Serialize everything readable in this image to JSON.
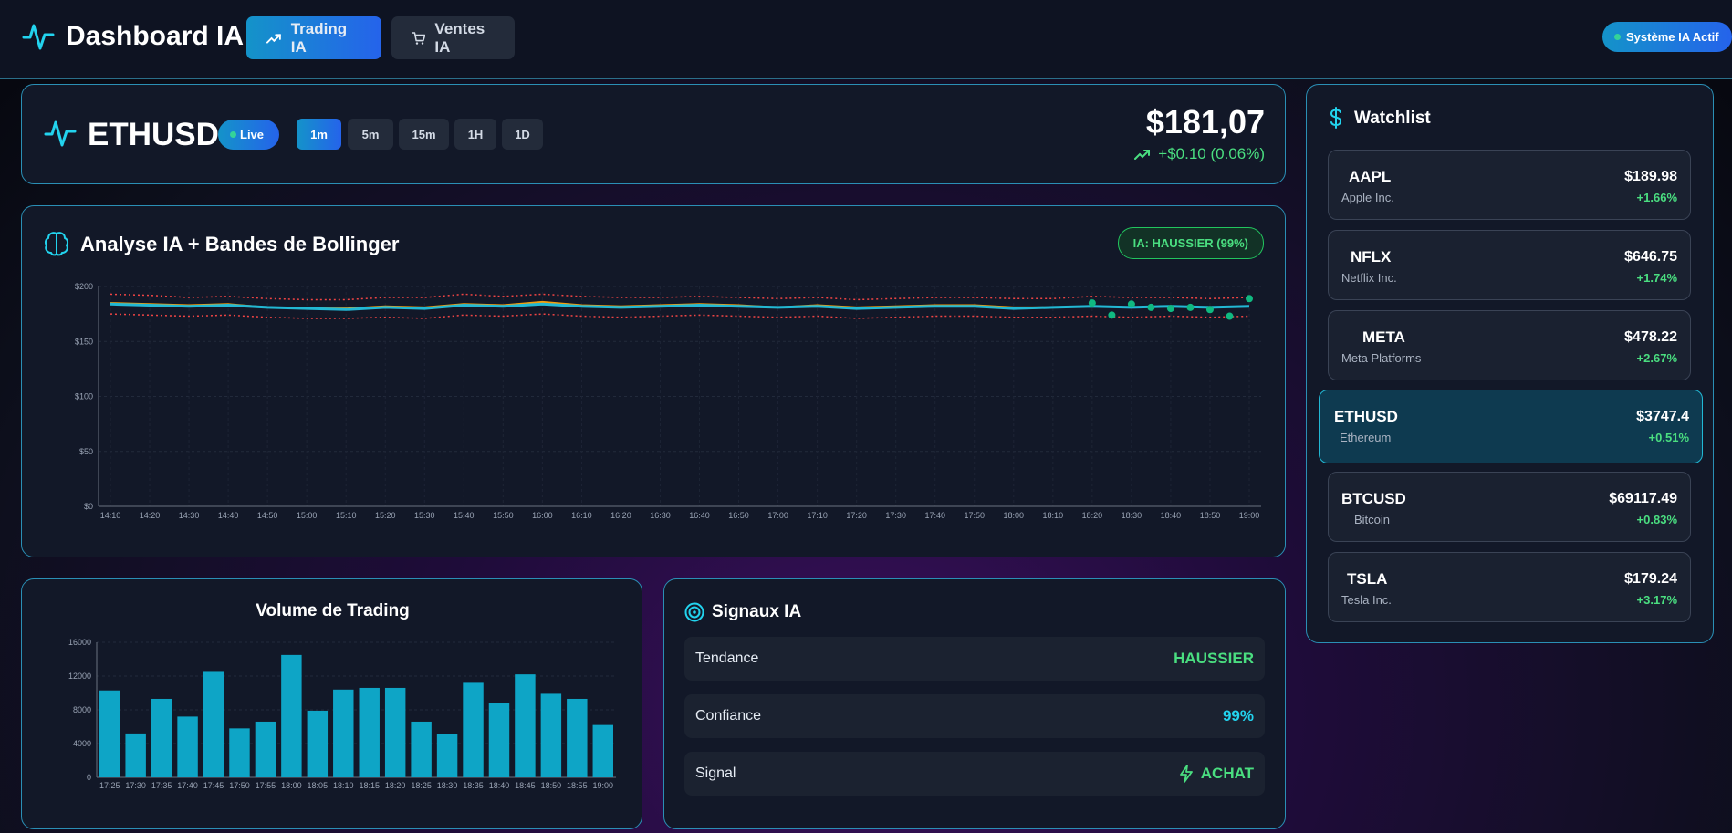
{
  "header": {
    "app_title": "Dashboard IA",
    "nav": [
      {
        "label": "Trading IA",
        "icon": "trending-up-icon",
        "active": true
      },
      {
        "label": "Ventes IA",
        "icon": "cart-icon",
        "active": false
      }
    ],
    "status": "Système IA Actif"
  },
  "ticker": {
    "symbol": "ETHUSD",
    "live_label": "Live",
    "timeframes": [
      "1m",
      "5m",
      "15m",
      "1H",
      "1D"
    ],
    "active_timeframe": "1m",
    "price": "$181,07",
    "change": "+$0.10 (0.06%)"
  },
  "analysis": {
    "title": "Analyse IA + Bandes de Bollinger",
    "badge": "IA: HAUSSIER (99%)"
  },
  "volume": {
    "title": "Volume de Trading"
  },
  "signals": {
    "title": "Signaux IA",
    "rows": [
      {
        "label": "Tendance",
        "value": "HAUSSIER",
        "color": "#4ade80"
      },
      {
        "label": "Confiance",
        "value": "99%",
        "color": "#22d3ee"
      },
      {
        "label": "Signal",
        "value": "ACHAT",
        "color": "#4ade80",
        "icon": "lightning-icon"
      }
    ]
  },
  "watchlist": {
    "title": "Watchlist",
    "items": [
      {
        "symbol": "AAPL",
        "name": "Apple Inc.",
        "price": "$189.98",
        "change": "+1.66%",
        "active": false
      },
      {
        "symbol": "NFLX",
        "name": "Netflix Inc.",
        "price": "$646.75",
        "change": "+1.74%",
        "active": false
      },
      {
        "symbol": "META",
        "name": "Meta Platforms",
        "price": "$478.22",
        "change": "+2.67%",
        "active": false
      },
      {
        "symbol": "ETHUSD",
        "name": "Ethereum",
        "price": "$3747.4",
        "change": "+0.51%",
        "active": true
      },
      {
        "symbol": "BTCUSD",
        "name": "Bitcoin",
        "price": "$69117.49",
        "change": "+0.83%",
        "active": false
      },
      {
        "symbol": "TSLA",
        "name": "Tesla Inc.",
        "price": "$179.24",
        "change": "+3.17%",
        "active": false
      }
    ]
  },
  "chart_data": [
    {
      "type": "line",
      "x": [
        "14:10",
        "14:20",
        "14:30",
        "14:40",
        "14:50",
        "15:00",
        "15:10",
        "15:20",
        "15:30",
        "15:40",
        "15:50",
        "16:00",
        "16:10",
        "16:20",
        "16:30",
        "16:40",
        "16:50",
        "17:00",
        "17:10",
        "17:20",
        "17:30",
        "17:40",
        "17:50",
        "18:00",
        "18:10",
        "18:20",
        "18:30",
        "18:40",
        "18:50",
        "19:00"
      ],
      "series": [
        {
          "values": [
            184,
            183,
            182,
            183,
            181,
            180,
            179,
            181,
            180,
            183,
            182,
            184,
            182,
            181,
            182,
            183,
            182,
            181,
            182,
            180,
            181,
            182,
            182,
            180,
            181,
            182,
            181,
            182,
            181,
            182
          ],
          "color": "#22b8d4"
        },
        {
          "values": [
            193,
            192,
            190,
            191,
            189,
            188,
            188,
            190,
            190,
            193,
            191,
            193,
            191,
            190,
            190,
            191,
            190,
            189,
            190,
            188,
            189,
            190,
            190,
            189,
            189,
            191,
            190,
            190,
            189,
            190
          ],
          "color": "#ef4444",
          "dash": true
        },
        {
          "values": [
            175,
            174,
            173,
            174,
            172,
            171,
            171,
            172,
            171,
            174,
            173,
            175,
            173,
            172,
            173,
            174,
            173,
            172,
            173,
            171,
            172,
            173,
            173,
            172,
            172,
            173,
            172,
            173,
            172,
            173
          ],
          "color": "#ef4444",
          "dash": true
        },
        {
          "values": [
            185,
            184,
            183,
            184,
            181,
            180,
            180,
            182,
            181,
            184,
            183,
            186,
            183,
            182,
            183,
            184,
            183,
            181,
            183,
            181,
            182,
            183,
            183,
            181,
            181,
            182,
            181,
            182,
            181,
            182
          ],
          "color": "#f59e0b"
        }
      ],
      "points": [
        [
          "18:20",
          185
        ],
        [
          "18:25",
          174
        ],
        [
          "18:30",
          184
        ],
        [
          "18:35",
          181
        ],
        [
          "18:40",
          180
        ],
        [
          "18:45",
          181
        ],
        [
          "18:50",
          179
        ],
        [
          "18:55",
          173
        ],
        [
          "19:00",
          189
        ]
      ],
      "ylim": [
        0,
        200
      ],
      "yticks": [
        "$0",
        "$50",
        "$100",
        "$150",
        "$200"
      ],
      "grid": true
    },
    {
      "type": "bar",
      "categories": [
        "17:25",
        "17:30",
        "17:35",
        "17:40",
        "17:45",
        "17:50",
        "17:55",
        "18:00",
        "18:05",
        "18:10",
        "18:15",
        "18:20",
        "18:25",
        "18:30",
        "18:35",
        "18:40",
        "18:45",
        "18:50",
        "18:55",
        "19:00"
      ],
      "values": [
        10300,
        5200,
        9300,
        7200,
        12600,
        5800,
        6600,
        14500,
        7900,
        10400,
        10600,
        10600,
        6600,
        5100,
        11200,
        8800,
        12200,
        9900,
        9300,
        6200
      ],
      "ylim": [
        0,
        16000
      ],
      "yticks": [
        "0",
        "4000",
        "8000",
        "12000",
        "16000"
      ],
      "color": "#0ea5c6"
    }
  ]
}
